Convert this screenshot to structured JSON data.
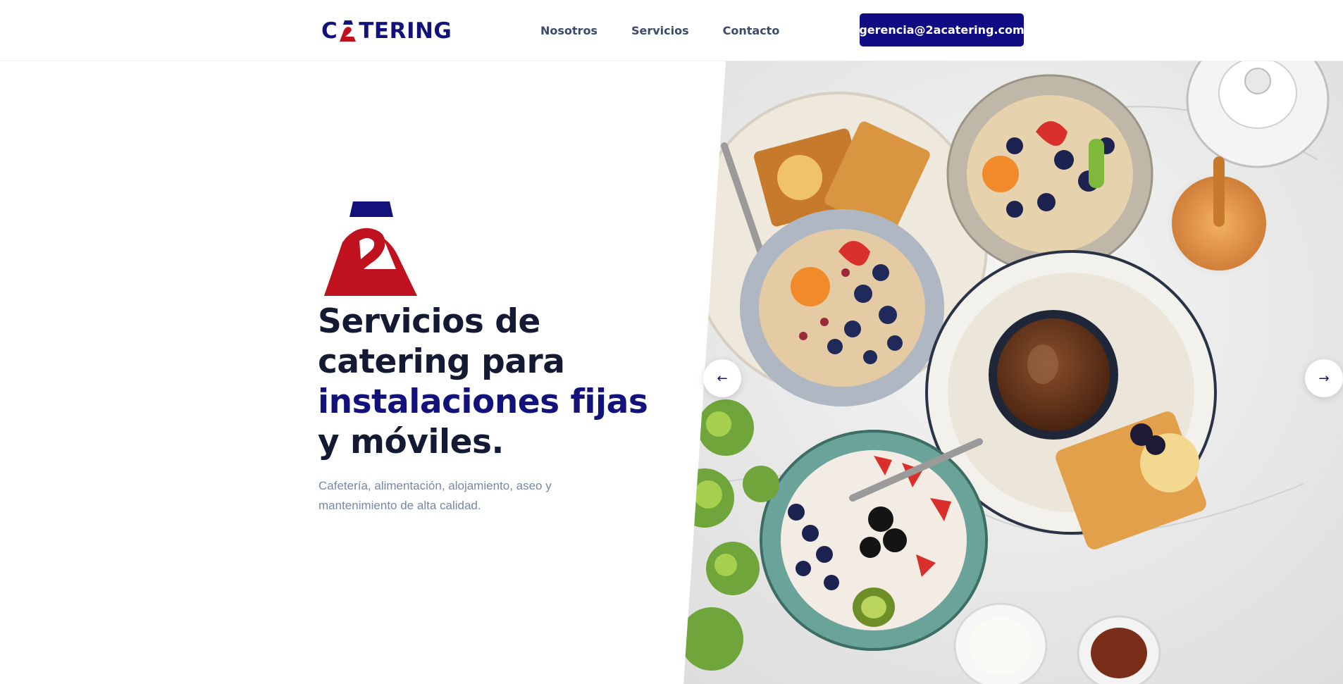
{
  "nav": {
    "logo_pre": "C",
    "logo_post": "TERING",
    "links": [
      {
        "label": "Nosotros"
      },
      {
        "label": "Servicios"
      },
      {
        "label": "Contacto"
      }
    ],
    "email_button": "gerencia@2acatering.com"
  },
  "hero": {
    "title_line1": "Servicios de",
    "title_line2": "catering para",
    "title_line3": "instalaciones fijas",
    "title_line4": "y móviles.",
    "subtitle_line1": "Cafetería, alimentación, alojamiento, aseo y",
    "subtitle_line2": "mantenimiento de alta calidad."
  },
  "carousel": {
    "prev_icon": "arrow-left-icon",
    "next_icon": "arrow-right-icon",
    "prev_glyph": "←",
    "next_glyph": "→"
  },
  "colors": {
    "brand_navy": "#13127a",
    "brand_red": "#c0111f",
    "button_bg": "#100c84",
    "heading": "#141a33",
    "muted": "#7b86a8"
  }
}
